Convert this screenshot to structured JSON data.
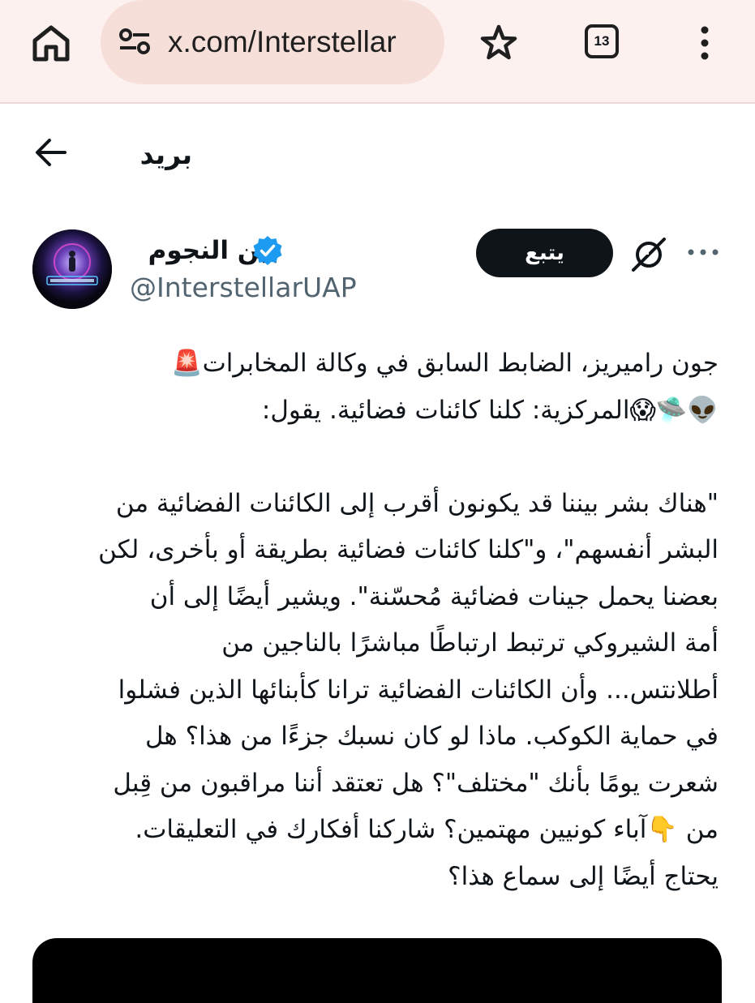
{
  "browser": {
    "url": "x.com/Interstellar",
    "tab_count": "13",
    "icons": [
      "home-icon",
      "site-settings-icon",
      "star-icon",
      "tabs-icon",
      "more-vert-icon"
    ]
  },
  "header": {
    "title": "بريد",
    "back_icon": "arrow-left-icon"
  },
  "author": {
    "display_name": "بين النجوم",
    "handle": "@InterstellarUAP",
    "verified": true,
    "follow_label": "يتبع",
    "accent_color": "#1d9bf0"
  },
  "tweet": {
    "lines": [
      "جون راميريز، الضابط السابق في وكالة المخابرات🚨",
      "👽🛸😱المركزية: كلنا كائنات فضائية. يقول:",
      "",
      "\"هناك بشر بيننا قد يكونون أقرب إلى الكائنات الفضائية من",
      "البشر أنفسهم\"، و\"كلنا كائنات فضائية بطريقة أو بأخرى، لكن",
      "بعضنا يحمل جينات فضائية مُحسّنة\". ويشير أيضًا إلى أن",
      "أمة الشيروكي ترتبط ارتباطًا مباشرًا بالناجين من",
      "أطلانتس... وأن الكائنات الفضائية ترانا كأبنائها الذين فشلوا",
      "في حماية الكوكب. ماذا لو كان نسبك جزءًا من هذا؟ هل",
      "شعرت يومًا بأنك \"مختلف\"؟ هل تعتقد أننا مراقبون من قِبل",
      "من 👇آباء كونيين مهتمين؟ شاركنا أفكارك في التعليقات.",
      "يحتاج أيضًا إلى سماع هذا؟"
    ]
  }
}
